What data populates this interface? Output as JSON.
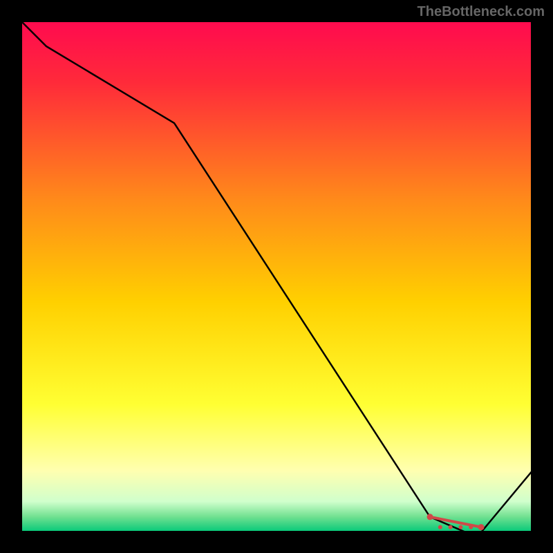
{
  "watermark": "TheBottleneck.com",
  "chart_data": {
    "type": "line",
    "x": [
      0,
      5,
      30,
      80,
      87,
      90,
      100
    ],
    "values": [
      100,
      95,
      80,
      3,
      0,
      0,
      12
    ],
    "flat_segment_label": "",
    "title": "",
    "xlabel": "",
    "ylabel": "",
    "xlim": [
      0,
      100
    ],
    "ylim": [
      0,
      100
    ],
    "background_gradient": {
      "stops": [
        {
          "offset": 0,
          "color": "#ff0a4f"
        },
        {
          "offset": 0.12,
          "color": "#ff2a3a"
        },
        {
          "offset": 0.35,
          "color": "#ff8a1a"
        },
        {
          "offset": 0.55,
          "color": "#ffd000"
        },
        {
          "offset": 0.75,
          "color": "#ffff33"
        },
        {
          "offset": 0.88,
          "color": "#ffffb0"
        },
        {
          "offset": 0.94,
          "color": "#d0ffcc"
        },
        {
          "offset": 0.97,
          "color": "#70e090"
        },
        {
          "offset": 1.0,
          "color": "#00c878"
        }
      ]
    },
    "marker_points": [
      {
        "x": 80,
        "y": 3
      },
      {
        "x": 82,
        "y": 1
      },
      {
        "x": 84,
        "y": 1
      },
      {
        "x": 86,
        "y": 1
      },
      {
        "x": 88,
        "y": 1
      },
      {
        "x": 90,
        "y": 1
      }
    ],
    "marker_label": ""
  }
}
